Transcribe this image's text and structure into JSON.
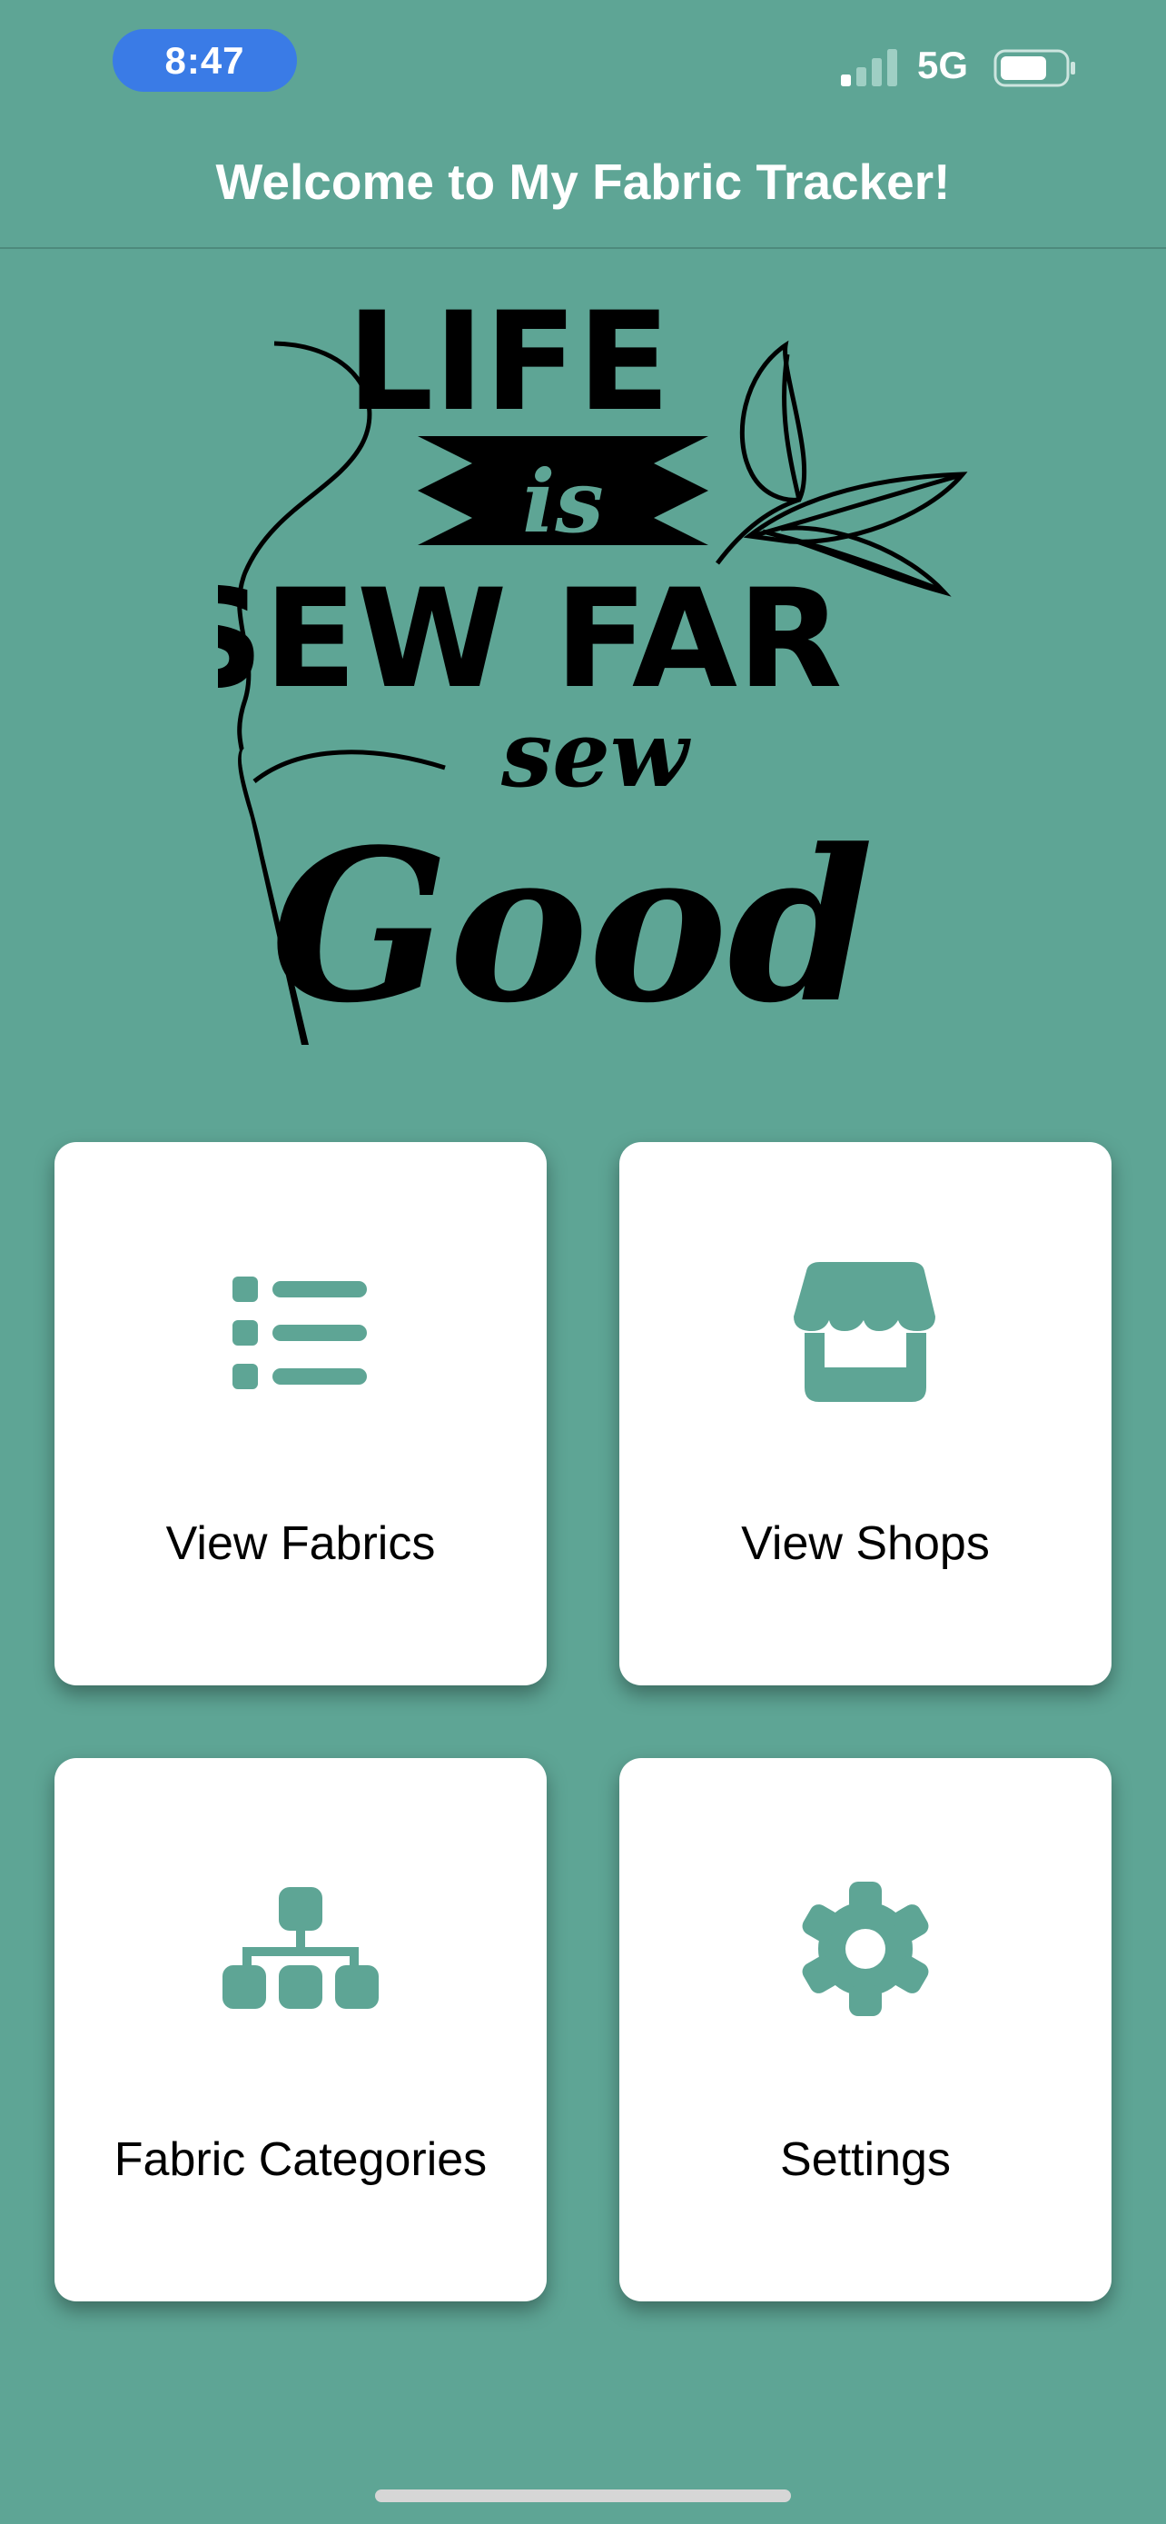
{
  "status_bar": {
    "time": "8:47",
    "network": "5G",
    "icons": [
      "signal-icon",
      "battery-icon"
    ]
  },
  "header": {
    "title": "Welcome to My Fabric Tracker!"
  },
  "logo": {
    "lines": [
      "LIFE",
      "is",
      "SEW FAR",
      "sew",
      "Good"
    ],
    "icons": [
      "needle-thread-icon",
      "leaves-icon"
    ]
  },
  "menu": {
    "items": [
      {
        "label": "View Fabrics",
        "icon": "list-icon"
      },
      {
        "label": "View Shops",
        "icon": "storefront-icon"
      },
      {
        "label": "Fabric Categories",
        "icon": "hierarchy-icon"
      },
      {
        "label": "Settings",
        "icon": "gear-icon"
      }
    ]
  },
  "colors": {
    "background": "#5ea595",
    "accent": "#5ea595",
    "time_pill": "#3a7be6",
    "card": "#ffffff",
    "text_dark": "#000000"
  }
}
